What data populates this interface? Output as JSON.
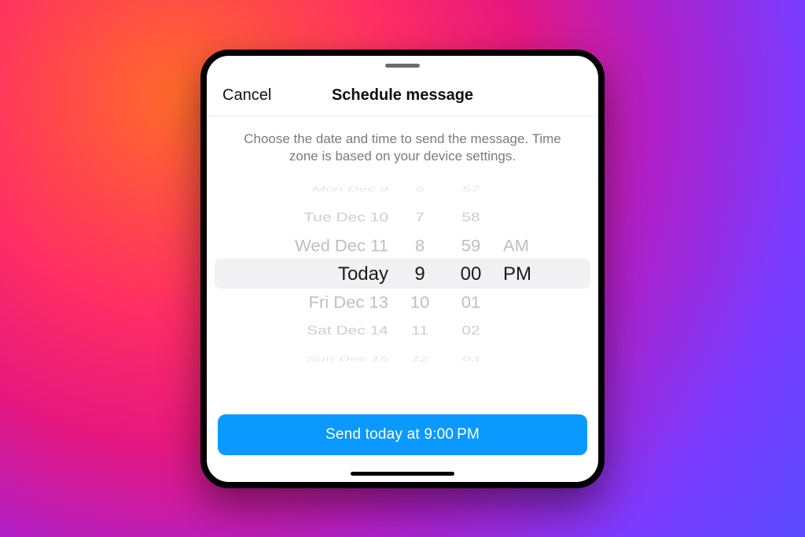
{
  "header": {
    "cancel": "Cancel",
    "title": "Schedule message"
  },
  "instruction": "Choose the date and time to send the message. Time zone is based on your device settings.",
  "picker": {
    "dates": [
      "Mon Dec 9",
      "Tue Dec 10",
      "Wed Dec 11",
      "Today",
      "Fri Dec 13",
      "Sat Dec 14",
      "Sun Dec 15"
    ],
    "hours": [
      "6",
      "7",
      "8",
      "9",
      "10",
      "11",
      "12"
    ],
    "minutes": [
      "57",
      "58",
      "59",
      "00",
      "01",
      "02",
      "03"
    ],
    "ampm": [
      "",
      "",
      "AM",
      "PM",
      "",
      "",
      ""
    ]
  },
  "button": {
    "send": "Send today at 9:00 PM"
  },
  "selection": {
    "date": "Today",
    "hour": "9",
    "minute": "00",
    "ampm": "PM"
  }
}
